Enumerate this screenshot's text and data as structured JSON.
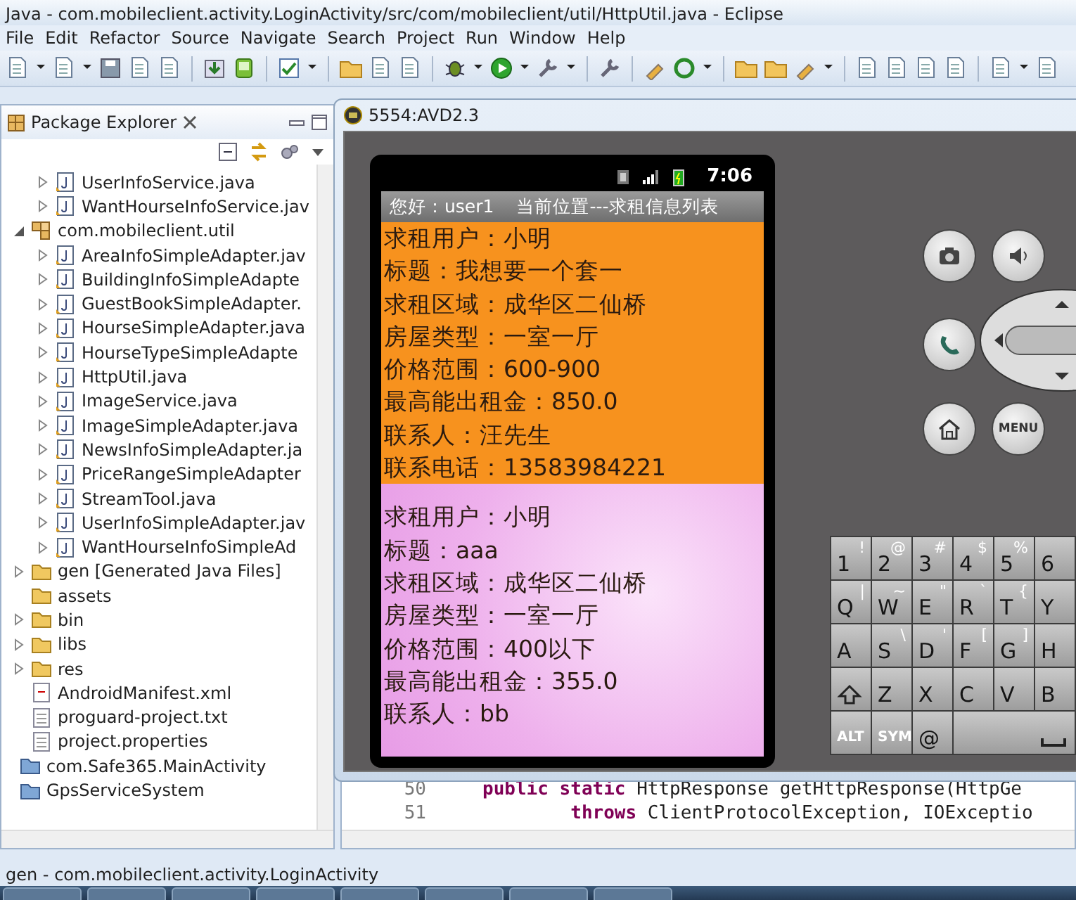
{
  "window": {
    "title": "Java - com.mobileclient.activity.LoginActivity/src/com/mobileclient/util/HttpUtil.java - Eclipse"
  },
  "menu": [
    "File",
    "Edit",
    "Refactor",
    "Source",
    "Navigate",
    "Search",
    "Project",
    "Run",
    "Window",
    "Help"
  ],
  "package_explorer": {
    "title": "Package Explorer",
    "tree": [
      {
        "children": [
          {
            "children": [
              {
                "label": "UserInfoService.java",
                "kind": "java",
                "expanded": false
              },
              {
                "label": "WantHourseInfoService.jav",
                "kind": "java",
                "expanded": false
              }
            ]
          },
          {
            "label": "com.mobileclient.util",
            "kind": "package",
            "expanded": true,
            "children": [
              {
                "label": "AreaInfoSimpleAdapter.jav",
                "kind": "java",
                "expanded": false
              },
              {
                "label": "BuildingInfoSimpleAdapte",
                "kind": "java",
                "expanded": false
              },
              {
                "label": "GuestBookSimpleAdapter.",
                "kind": "java",
                "expanded": false
              },
              {
                "label": "HourseSimpleAdapter.java",
                "kind": "java",
                "expanded": false
              },
              {
                "label": "HourseTypeSimpleAdapte",
                "kind": "java",
                "expanded": false
              },
              {
                "label": "HttpUtil.java",
                "kind": "java",
                "expanded": false
              },
              {
                "label": "ImageService.java",
                "kind": "java",
                "expanded": false
              },
              {
                "label": "ImageSimpleAdapter.java",
                "kind": "java",
                "expanded": false
              },
              {
                "label": "NewsInfoSimpleAdapter.ja",
                "kind": "java",
                "expanded": false
              },
              {
                "label": "PriceRangeSimpleAdapter",
                "kind": "java",
                "expanded": false
              },
              {
                "label": "StreamTool.java",
                "kind": "java",
                "expanded": false
              },
              {
                "label": "UserInfoSimpleAdapter.jav",
                "kind": "java",
                "expanded": false
              },
              {
                "label": "WantHourseInfoSimpleAd",
                "kind": "java",
                "expanded": false
              }
            ]
          },
          {
            "label": "gen [Generated Java Files]",
            "kind": "folder",
            "expanded": false
          },
          {
            "label": "assets",
            "kind": "folder"
          },
          {
            "label": "bin",
            "kind": "folder",
            "expanded": false
          },
          {
            "label": "libs",
            "kind": "folder",
            "expanded": false
          },
          {
            "label": "res",
            "kind": "folder",
            "expanded": false
          },
          {
            "label": "AndroidManifest.xml",
            "kind": "xml"
          },
          {
            "label": "proguard-project.txt",
            "kind": "text"
          },
          {
            "label": "project.properties",
            "kind": "text"
          }
        ]
      },
      {
        "label": "com.Safe365.MainActivity",
        "kind": "project"
      },
      {
        "label": "GpsServiceSystem",
        "kind": "project"
      }
    ]
  },
  "editor": {
    "lines": [
      {
        "number": "50",
        "code": "**public static** HttpResponse getHttpResponse(HttpGe"
      },
      {
        "number": "51",
        "code": "        **throws** ClientProtocolException, IOExceptio"
      }
    ]
  },
  "status_bar": "gen - com.mobileclient.activity.LoginActivity",
  "emulator": {
    "title": "5554:AVD2.3",
    "time": "7:06",
    "app_header": [
      "您好：user1",
      "当前位置---求租信息列表"
    ],
    "listings": [
      {
        "color": "#f7921e",
        "kind": "plain",
        "lines": [
          "求租用户：小明",
          "标题：我想要一个套一",
          "求租区域：成华区二仙桥",
          "房屋类型：一室一厅",
          "价格范围：600-900",
          "最高能出租金：850.0",
          "联系人：汪先生",
          "联系电话：13583984221"
        ]
      },
      {
        "color": "#f0b8ee",
        "kind": "pattern",
        "lines": [
          "求租用户：小明",
          "标题：aaa",
          "求租区域：成华区二仙桥",
          "房屋类型：一室一厅",
          "价格范围：400以下",
          "最高能出租金：355.0",
          "联系人：bb"
        ]
      }
    ],
    "menu_key": "MENU",
    "keyboard": [
      [
        {
          "label": "1",
          "alt": "!"
        },
        {
          "label": "2",
          "alt": "@"
        },
        {
          "label": "3",
          "alt": "#"
        },
        {
          "label": "4",
          "alt": "$"
        },
        {
          "label": "5",
          "alt": "%"
        },
        {
          "label": "6"
        }
      ],
      [
        {
          "label": "Q",
          "alt": "|"
        },
        {
          "label": "W",
          "alt": "~"
        },
        {
          "label": "E",
          "alt": "\""
        },
        {
          "label": "R",
          "alt": "`"
        },
        {
          "label": "T",
          "alt": "{"
        },
        {
          "label": "Y"
        }
      ],
      [
        {
          "label": "A"
        },
        {
          "label": "S",
          "alt": "\\"
        },
        {
          "label": "D",
          "alt": "'"
        },
        {
          "label": "F",
          "alt": "["
        },
        {
          "label": "G",
          "alt": "]"
        },
        {
          "label": "H"
        }
      ],
      [
        {
          "kind": "shift"
        },
        {
          "label": "Z"
        },
        {
          "label": "X"
        },
        {
          "label": "C"
        },
        {
          "label": "V"
        },
        {
          "label": "B"
        }
      ],
      [
        {
          "label": "ALT",
          "kind": "small"
        },
        {
          "label": "SYM",
          "kind": "small"
        },
        {
          "label": "@"
        },
        {
          "kind": "space"
        }
      ]
    ]
  }
}
